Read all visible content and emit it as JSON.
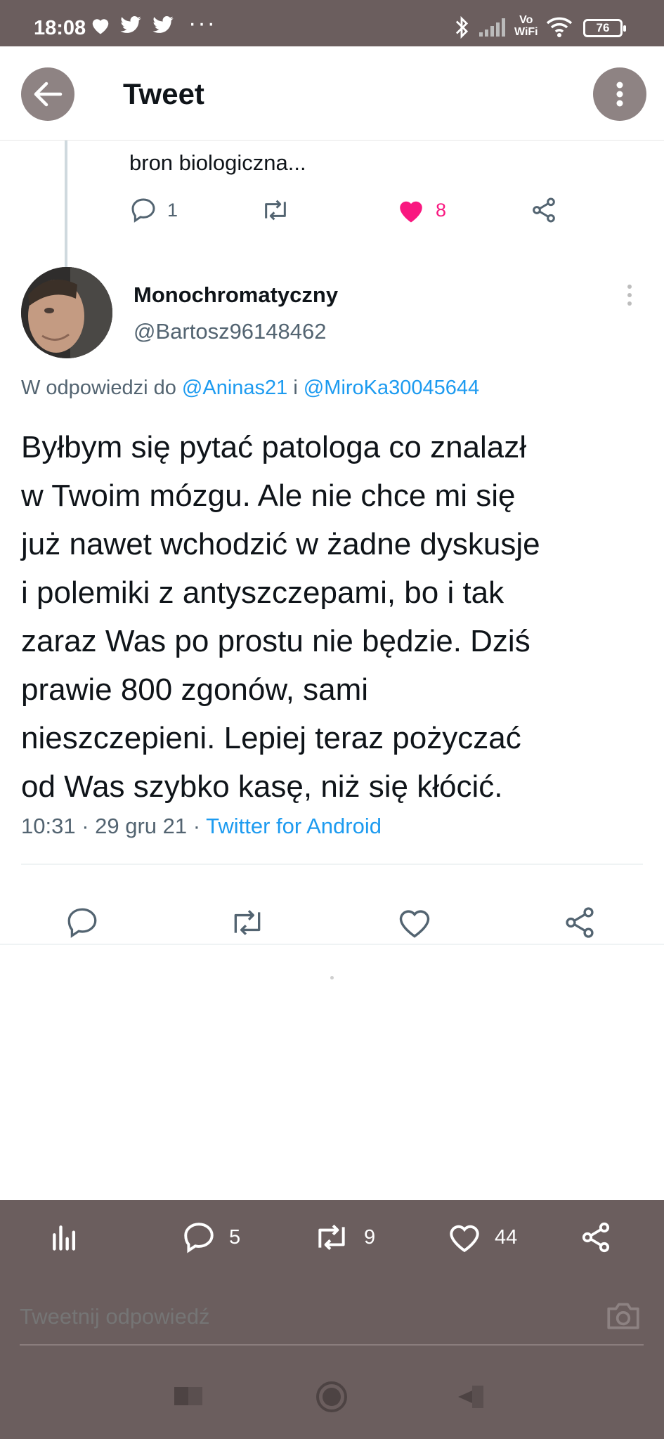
{
  "status_bar": {
    "time": "18:08",
    "dots": "···",
    "network": "Vo\nWiFi",
    "battery": "76"
  },
  "header": {
    "title": "Tweet"
  },
  "previous_tweet": {
    "text": "bron biologiczna...",
    "reply_count": "1",
    "like_count": "8"
  },
  "tweet": {
    "author_name": "Monochromatyczny",
    "author_handle": "@Bartosz96148462",
    "reply_prefix": "W odpowiedzi do ",
    "mention_1": "@Aninas21",
    "reply_joiner": " i ",
    "mention_2": "@MiroKa30045644",
    "text": "Byłbym się pytać patologa co znalazł\nw Twoim mózgu. Ale nie chce mi się\njuż  nawet wchodzić w żadne dyskusje\ni polemiki z antyszczepami, bo i tak\nzaraz Was po prostu nie będzie. Dziś\nprawie 800 zgonów, sami\nnieszczepieni. Lepiej teraz pożyczać\nod Was szybko kasę, niż się kłócić.",
    "time": "10:31 · 29 gru 21 · ",
    "source": "Twitter for Android"
  },
  "stats_bar": {
    "replies": "5",
    "retweets": "9",
    "likes": "44"
  },
  "reply_box": {
    "placeholder": "Tweetnij odpowiedź"
  },
  "colors": {
    "link": "#1d9bf0",
    "like_active": "#f91880",
    "chrome": "#6b5e5e"
  }
}
